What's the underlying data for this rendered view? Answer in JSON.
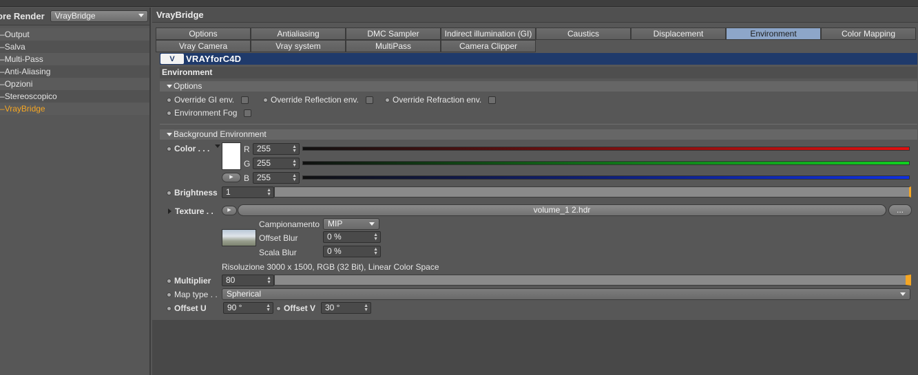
{
  "left_panel": {
    "title": "ore Render",
    "renderer_select": "VrayBridge",
    "items": [
      {
        "label": "Output"
      },
      {
        "label": "Salva"
      },
      {
        "label": "Multi-Pass"
      },
      {
        "label": "Anti-Aliasing"
      },
      {
        "label": "Opzioni"
      },
      {
        "label": "Stereoscopico"
      },
      {
        "label": "VrayBridge"
      }
    ],
    "active_item": "VrayBridge"
  },
  "right_panel": {
    "title": "VrayBridge",
    "tabs_row1": [
      "Options",
      "Antialiasing",
      "DMC Sampler",
      "Indirect illumination (GI)",
      "Caustics",
      "Displacement",
      "Environment",
      "Color Mapping"
    ],
    "tabs_row2": [
      "Vray Camera",
      "Vray system",
      "MultiPass",
      "Camera Clipper"
    ],
    "active_tab": "Environment",
    "logo": {
      "mark": "V",
      "text": "VRAYforC4D"
    },
    "section_title": "Environment",
    "options_group": {
      "title": "Options",
      "override_gi": "Override GI env.",
      "override_reflection": "Override Reflection env.",
      "override_refraction": "Override Refraction env.",
      "environment_fog": "Environment Fog"
    },
    "background_group": {
      "title": "Background Environment",
      "color_label": "Color . . .",
      "r_label": "R",
      "r_value": "255",
      "g_label": "G",
      "g_value": "255",
      "b_label": "B",
      "b_value": "255",
      "brightness_label": "Brightness",
      "brightness_value": "1",
      "texture_label": "Texture . .",
      "texture_file": "volume_1 2.hdr",
      "browse_label": "...",
      "sampling_label": "Campionamento",
      "sampling_value": "MIP",
      "offset_blur_label": "Offset Blur",
      "offset_blur_value": "0 %",
      "scale_blur_label": "Scala Blur",
      "scale_blur_value": "0 %",
      "resolution_text": "Risoluzione 3000 x 1500, RGB (32 Bit), Linear Color Space",
      "multiplier_label": "Multiplier",
      "multiplier_value": "80",
      "map_type_label": "Map type . .",
      "map_type_value": "Spherical",
      "offset_u_label": "Offset U",
      "offset_u_value": "90 °",
      "offset_v_label": "Offset V",
      "offset_v_value": "30 °"
    }
  },
  "colors": {
    "accent_orange": "#f5a623",
    "active_tab": "#8da6c9",
    "banner": "#1f3a6b",
    "red_line": "#e01010",
    "green_line": "#10d020",
    "blue_line": "#1030e0"
  }
}
